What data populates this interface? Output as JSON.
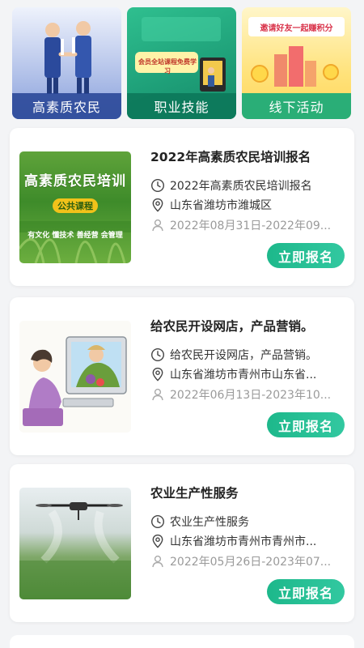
{
  "categories": [
    {
      "label": "高素质农民"
    },
    {
      "label": "职业技能"
    },
    {
      "label": "线下活动"
    }
  ],
  "category_art": {
    "skills_banner": "会员全站课程免费学习",
    "invite_banner": "邀请好友一起赚积分"
  },
  "thumb_text": {
    "headline": "高素质农民培训",
    "pill": "公共课程",
    "foot": "有文化  懂技术  善经营  会管理"
  },
  "cards": [
    {
      "title": "2022年高素质农民培训报名",
      "subtitle": "2022年高素质农民培训报名",
      "location": "山东省潍坊市潍城区",
      "dates": "2022年08月31日-2022年09...",
      "cta": "立即报名"
    },
    {
      "title": "给农民开设网店，产品营销。",
      "subtitle": "给农民开设网店，产品营销。",
      "location": "山东省潍坊市青州市山东省...",
      "dates": "2022年06月13日-2023年10...",
      "cta": "立即报名"
    },
    {
      "title": "农业生产性服务",
      "subtitle": "农业生产性服务",
      "location": "山东省潍坊市青州市青州市...",
      "dates": "2022年05月26日-2023年07...",
      "cta": "立即报名"
    }
  ],
  "icons": {
    "clock": "clock-icon",
    "location": "location-pin-icon",
    "person": "person-icon"
  },
  "colors": {
    "accent": "#1db88b",
    "background": "#f3f4f6"
  }
}
